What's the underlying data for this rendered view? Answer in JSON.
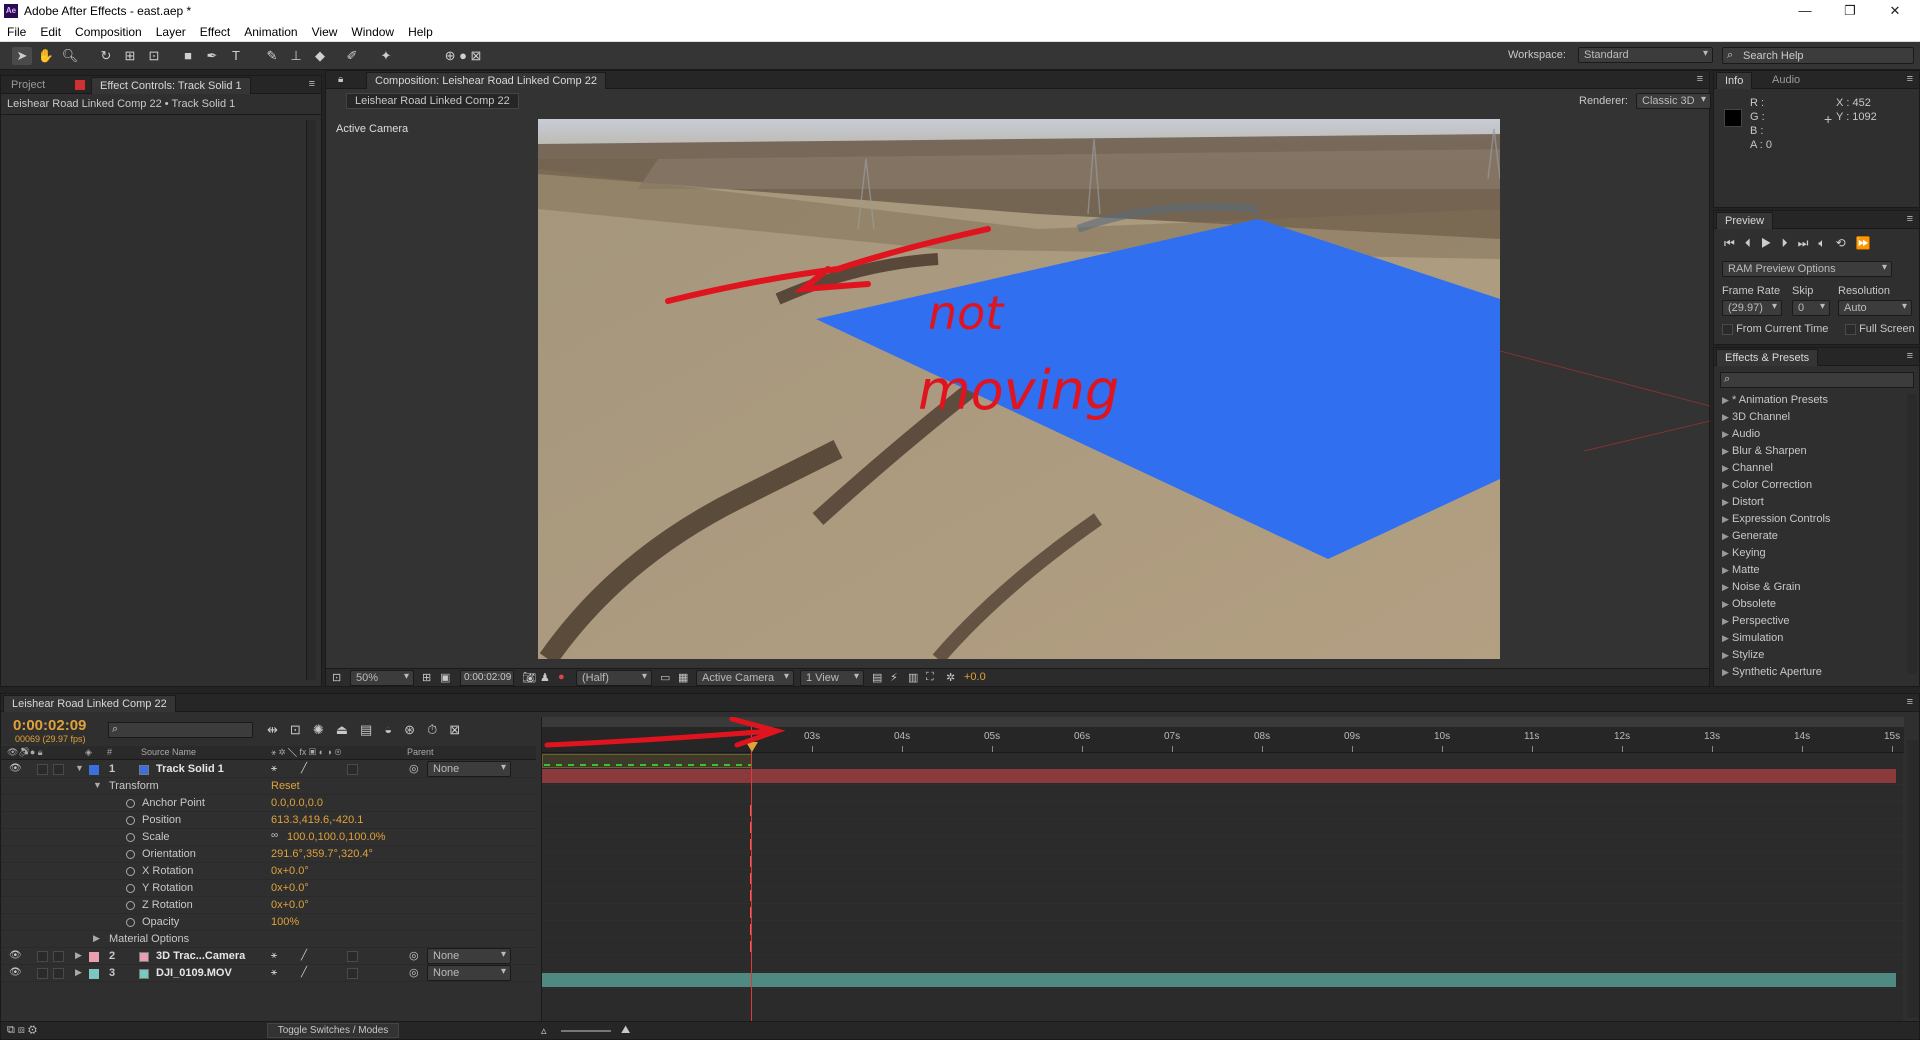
{
  "window": {
    "title": "Adobe After Effects - east.aep *",
    "app_icon": "Ae"
  },
  "menu": [
    "File",
    "Edit",
    "Composition",
    "Layer",
    "Effect",
    "Animation",
    "View",
    "Window",
    "Help"
  ],
  "toolbar": {
    "workspace_label": "Workspace:",
    "workspace_value": "Standard",
    "search_placeholder": "Search Help"
  },
  "left_panel": {
    "tab_project": "Project",
    "tab_effect_controls": "Effect Controls: Track Solid 1",
    "breadcrumb": "Leishear Road Linked Comp 22 • Track Solid 1"
  },
  "comp_panel": {
    "tab": "Composition: Leishear Road Linked Comp 22",
    "subtab": "Leishear Road Linked Comp 22",
    "renderer_label": "Renderer:",
    "renderer_value": "Classic 3D",
    "camera_label": "Active Camera"
  },
  "viewer_controls": {
    "zoom": "50%",
    "timecode": "0:00:02:09",
    "resolution": "(Half)",
    "camera": "Active Camera",
    "views": "1 View",
    "exposure": "+0.0"
  },
  "annotation": {
    "text_line1": "not",
    "text_line2": "moving",
    "color": "#e0141e"
  },
  "solid_color": "#2f6ff0",
  "info_panel": {
    "tab_info": "Info",
    "tab_audio": "Audio",
    "r": "R :",
    "g": "G :",
    "b": "B :",
    "a": "A : 0",
    "x": "X : 452",
    "y": "Y : 1092"
  },
  "preview_panel": {
    "tab": "Preview",
    "ram_options": "RAM Preview Options",
    "frame_rate_label": "Frame Rate",
    "skip_label": "Skip",
    "resolution_label": "Resolution",
    "frame_rate": "(29.97)",
    "skip": "0",
    "resolution": "Auto",
    "from_current": "From Current Time",
    "full_screen": "Full Screen"
  },
  "effects_panel": {
    "tab": "Effects & Presets",
    "items": [
      "* Animation Presets",
      "3D Channel",
      "Audio",
      "Blur & Sharpen",
      "Channel",
      "Color Correction",
      "Distort",
      "Expression Controls",
      "Generate",
      "Keying",
      "Matte",
      "Noise & Grain",
      "Obsolete",
      "Perspective",
      "Simulation",
      "Stylize",
      "Synthetic Aperture"
    ]
  },
  "timeline": {
    "tab": "Leishear Road Linked Comp 22",
    "timecode": "0:00:02:09",
    "frame_info": "00069 (29.97 fps)",
    "col_source": "Source Name",
    "col_parent": "Parent",
    "reset_label": "Reset",
    "toggle_label": "Toggle Switches / Modes",
    "ruler": [
      "03s",
      "04s",
      "05s",
      "06s",
      "07s",
      "08s",
      "09s",
      "10s",
      "11s",
      "12s",
      "13s",
      "14s",
      "15s"
    ],
    "layers": [
      {
        "num": "1",
        "name": "Track Solid 1",
        "color": "#3a6fe0",
        "parent": "None"
      },
      {
        "num": "2",
        "name": "3D Trac...Camera",
        "color": "#e8a0b0",
        "parent": "None"
      },
      {
        "num": "3",
        "name": "DJI_0109.MOV",
        "color": "#7ac8c0",
        "parent": "None"
      }
    ],
    "transform_label": "Transform",
    "material_label": "Material Options",
    "properties": [
      {
        "name": "Anchor Point",
        "value": "0.0,0.0,0.0"
      },
      {
        "name": "Position",
        "value": "613.3,419.6,-420.1"
      },
      {
        "name": "Scale",
        "value": "100.0,100.0,100.0%"
      },
      {
        "name": "Orientation",
        "value": "291.6°,359.7°,320.4°"
      },
      {
        "name": "X Rotation",
        "value": "0x+0.0°"
      },
      {
        "name": "Y Rotation",
        "value": "0x+0.0°"
      },
      {
        "name": "Z Rotation",
        "value": "0x+0.0°"
      },
      {
        "name": "Opacity",
        "value": "100%"
      }
    ]
  }
}
